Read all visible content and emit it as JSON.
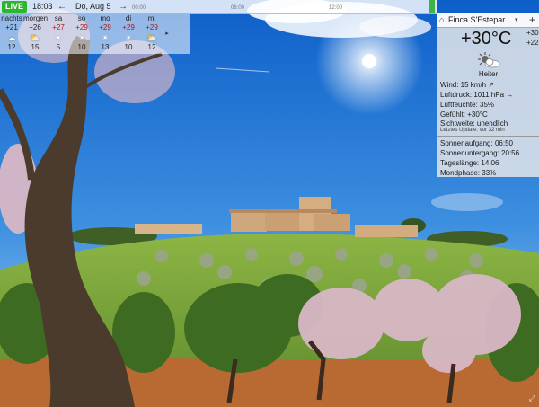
{
  "timeline": {
    "live_label": "LIVE",
    "time": "18:03",
    "prev_arrow": "←",
    "date": "Do, Aug 5",
    "next_arrow": "→",
    "ticks": [
      "00:00",
      "06:00",
      "12:00"
    ]
  },
  "forecast": {
    "days": [
      {
        "day": "nachts",
        "high": "+21",
        "icon": "moon-cloud-icon",
        "glyph": "☁",
        "low": "12"
      },
      {
        "day": "morgen",
        "high": "+26",
        "icon": "sun-cloud-icon",
        "glyph": "⛅",
        "low": "15"
      },
      {
        "day": "sa",
        "high": "+27",
        "icon": "sun-icon",
        "glyph": "☀",
        "low": "5"
      },
      {
        "day": "so",
        "high": "+29",
        "icon": "sun-icon",
        "glyph": "☀",
        "low": "10"
      },
      {
        "day": "mo",
        "high": "+29",
        "icon": "sun-icon",
        "glyph": "☀",
        "low": "13"
      },
      {
        "day": "di",
        "high": "+29",
        "icon": "sun-icon",
        "glyph": "☀",
        "low": "10"
      },
      {
        "day": "mi",
        "high": "+29",
        "icon": "sun-cloud-icon",
        "glyph": "⛅",
        "low": "12"
      }
    ],
    "more_glyph": "▸"
  },
  "panel": {
    "home_glyph": "⌂",
    "location": "Finca S'Estepar",
    "dropdown_glyph": "▾",
    "add_glyph": "+",
    "temperature": "+30°C",
    "high": "+30",
    "low": "+22",
    "condition_icon": "sun-cloud-icon",
    "condition": "Heiter",
    "wind": "Wind:  15 km/h ↗",
    "pressure": "Luftdruck:  1011 hPa →",
    "humidity": "Luftfeuchte:  35%",
    "feels": "Gefühlt:  +30°C",
    "visibility": "Sichtweite:  unendlich",
    "updated": "Letztes Update:  vor 32 min",
    "sunrise": "Sonnenaufgang:  06:50",
    "sunset": "Sonnenuntergang:  20:56",
    "daylength": "Tageslänge:  14:06",
    "moonphase": "Mondphase:  33%"
  },
  "colors": {
    "live": "#2db52d",
    "sky_top": "#0d5fc9",
    "sky_bottom": "#8fc3ef",
    "grass": "#7da63a",
    "soil": "#b96a33"
  },
  "corner_glyph": "⤢"
}
